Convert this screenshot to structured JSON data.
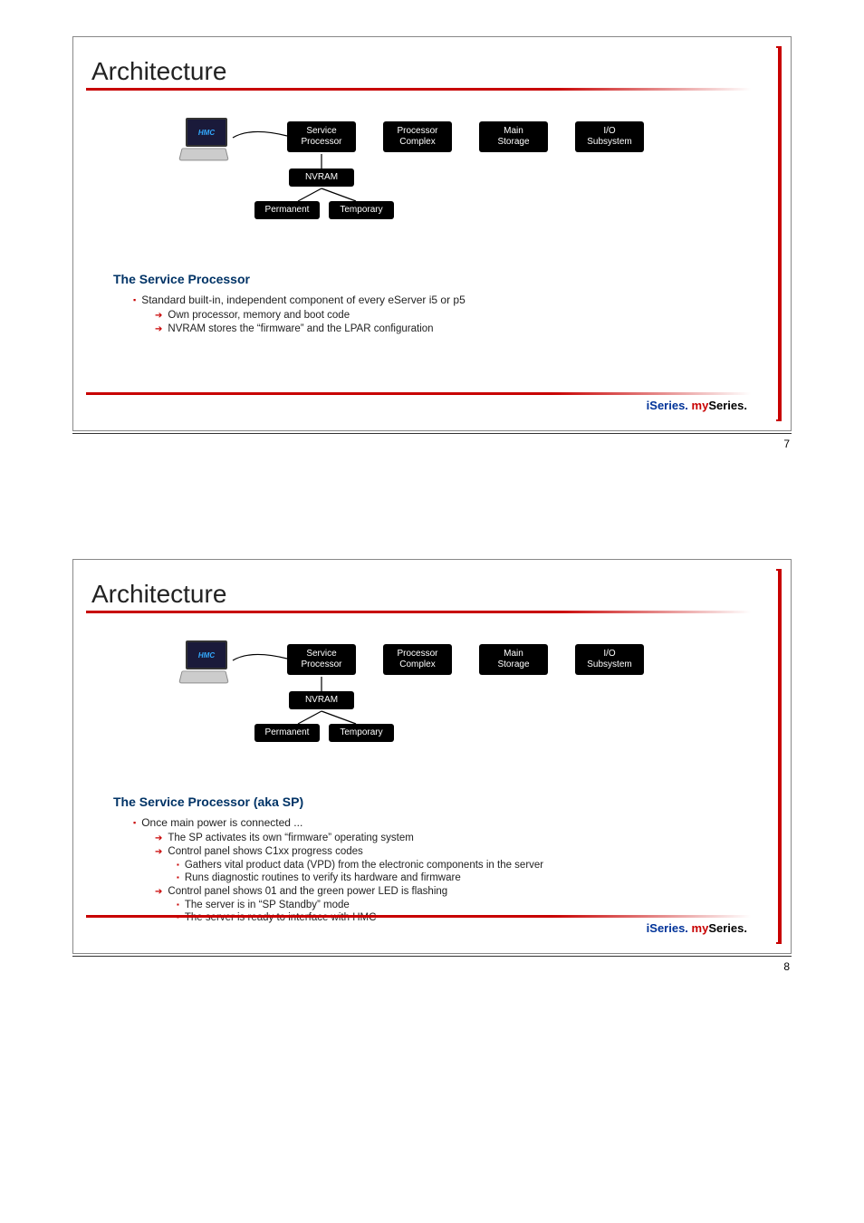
{
  "slides": [
    {
      "title": "Architecture",
      "diagram": {
        "hmc_label": "HMC",
        "boxes": {
          "service_processor": "Service\nProcessor",
          "processor_complex": "Processor\nComplex",
          "main_storage": "Main\nStorage",
          "io_subsystem": "I/O\nSubsystem",
          "nvram": "NVRAM",
          "permanent": "Permanent",
          "temporary": "Temporary"
        }
      },
      "section": "The Service Processor",
      "bullets": [
        {
          "level": 1,
          "text": "Standard built-in, independent component of every eServer i5 or p5"
        },
        {
          "level": 2,
          "text": "Own processor, memory and boot code"
        },
        {
          "level": 2,
          "text": "NVRAM stores the “firmware” and the LPAR configuration"
        }
      ],
      "footer": {
        "part1": "iSeries.",
        "part2": "my",
        "part3": "Series."
      },
      "page_number": "7"
    },
    {
      "title": "Architecture",
      "diagram": {
        "hmc_label": "HMC",
        "boxes": {
          "service_processor": "Service\nProcessor",
          "processor_complex": "Processor\nComplex",
          "main_storage": "Main\nStorage",
          "io_subsystem": "I/O\nSubsystem",
          "nvram": "NVRAM",
          "permanent": "Permanent",
          "temporary": "Temporary"
        }
      },
      "section": "The Service Processor (aka SP)",
      "bullets": [
        {
          "level": 1,
          "text": "Once main power is connected ..."
        },
        {
          "level": 2,
          "text": "The SP activates its own “firmware” operating system"
        },
        {
          "level": 2,
          "text": "Control panel shows C1xx progress codes"
        },
        {
          "level": 3,
          "text": "Gathers vital product data (VPD) from the electronic components in the server"
        },
        {
          "level": 3,
          "text": "Runs diagnostic routines to verify its hardware and firmware"
        },
        {
          "level": 2,
          "text": "Control panel shows 01 and the green power LED is flashing"
        },
        {
          "level": 3,
          "text": "The server is in “SP Standby” mode"
        },
        {
          "level": 3,
          "text": "The server is ready to interface with HMC"
        }
      ],
      "footer": {
        "part1": "iSeries.",
        "part2": "my",
        "part3": "Series."
      },
      "page_number": "8"
    }
  ]
}
